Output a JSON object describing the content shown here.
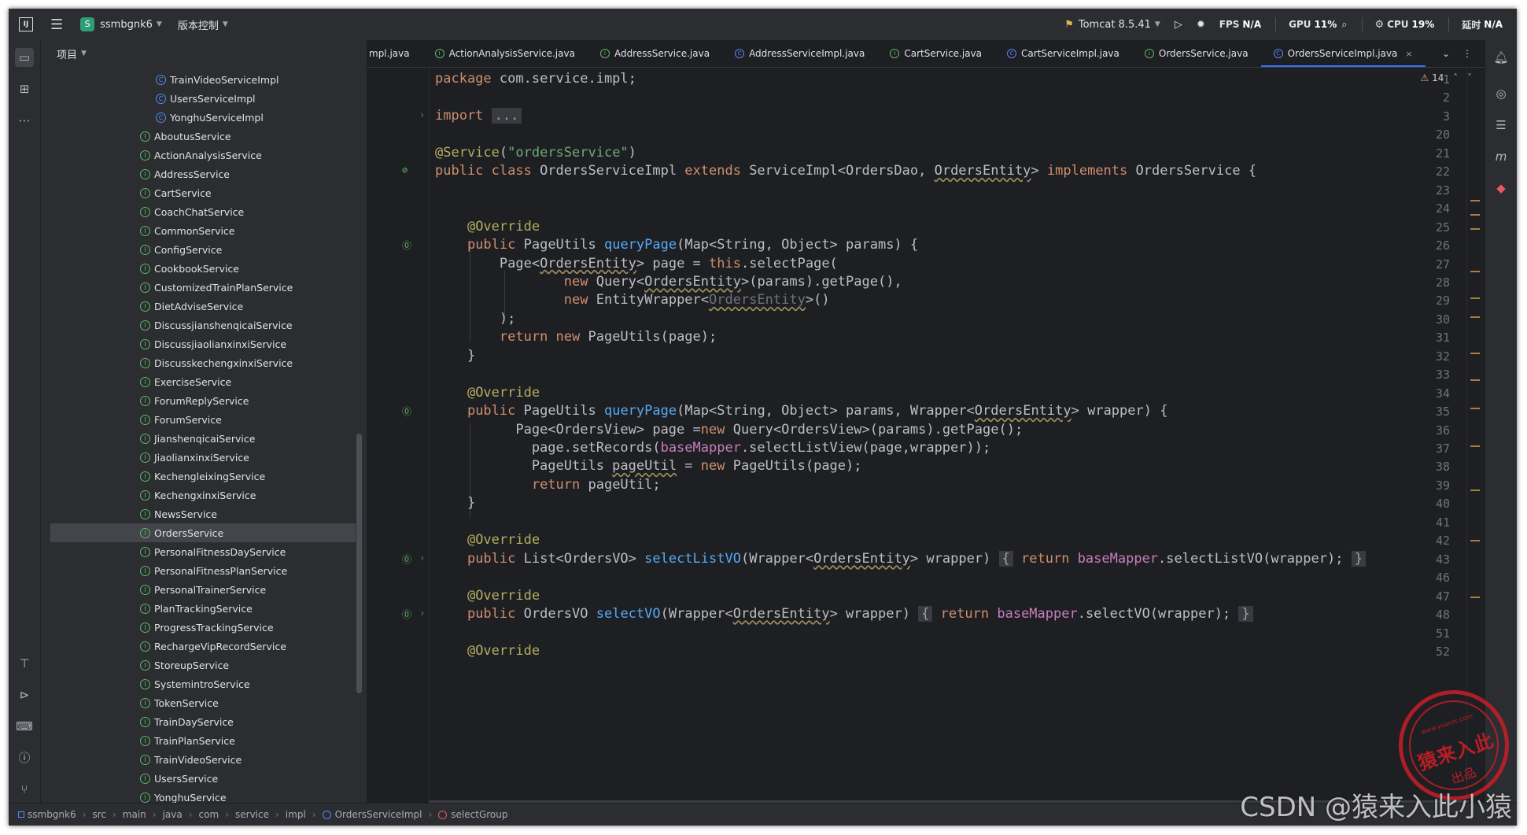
{
  "titlebar": {
    "project_badge": "S",
    "project_name": "ssmbgnk6",
    "vcs": "版本控制",
    "run_config": "Tomcat 8.5.41",
    "fps_label": "FPS",
    "fps_value": "N/A",
    "gpu_label": "GPU",
    "gpu_value": "11%",
    "cpu_label": "CPU",
    "cpu_value": "19%",
    "time_label": "延时",
    "time_value": "N/A"
  },
  "project_panel": {
    "title": "项目",
    "items": [
      {
        "label": "TrainVideoServiceImpl",
        "kind": "class",
        "indent": 2
      },
      {
        "label": "UsersServiceImpl",
        "kind": "class",
        "indent": 2
      },
      {
        "label": "YonghuServiceImpl",
        "kind": "class",
        "indent": 2
      },
      {
        "label": "AboutusService",
        "kind": "interface",
        "indent": 1
      },
      {
        "label": "ActionAnalysisService",
        "kind": "interface",
        "indent": 1
      },
      {
        "label": "AddressService",
        "kind": "interface",
        "indent": 1
      },
      {
        "label": "CartService",
        "kind": "interface",
        "indent": 1
      },
      {
        "label": "CoachChatService",
        "kind": "interface",
        "indent": 1
      },
      {
        "label": "CommonService",
        "kind": "interface",
        "indent": 1
      },
      {
        "label": "ConfigService",
        "kind": "interface",
        "indent": 1
      },
      {
        "label": "CookbookService",
        "kind": "interface",
        "indent": 1
      },
      {
        "label": "CustomizedTrainPlanService",
        "kind": "interface",
        "indent": 1
      },
      {
        "label": "DietAdviseService",
        "kind": "interface",
        "indent": 1
      },
      {
        "label": "DiscussjianshenqicaiService",
        "kind": "interface",
        "indent": 1
      },
      {
        "label": "DiscussjiaolianxinxiService",
        "kind": "interface",
        "indent": 1
      },
      {
        "label": "DiscusskechengxinxiService",
        "kind": "interface",
        "indent": 1
      },
      {
        "label": "ExerciseService",
        "kind": "interface",
        "indent": 1
      },
      {
        "label": "ForumReplyService",
        "kind": "interface",
        "indent": 1
      },
      {
        "label": "ForumService",
        "kind": "interface",
        "indent": 1
      },
      {
        "label": "JianshenqicaiService",
        "kind": "interface",
        "indent": 1
      },
      {
        "label": "JiaolianxinxiService",
        "kind": "interface",
        "indent": 1
      },
      {
        "label": "KechengleixingService",
        "kind": "interface",
        "indent": 1
      },
      {
        "label": "KechengxinxiService",
        "kind": "interface",
        "indent": 1
      },
      {
        "label": "NewsService",
        "kind": "interface",
        "indent": 1
      },
      {
        "label": "OrdersService",
        "kind": "interface",
        "indent": 1,
        "selected": true
      },
      {
        "label": "PersonalFitnessDayService",
        "kind": "interface",
        "indent": 1
      },
      {
        "label": "PersonalFitnessPlanService",
        "kind": "interface",
        "indent": 1
      },
      {
        "label": "PersonalTrainerService",
        "kind": "interface",
        "indent": 1
      },
      {
        "label": "PlanTrackingService",
        "kind": "interface",
        "indent": 1
      },
      {
        "label": "ProgressTrackingService",
        "kind": "interface",
        "indent": 1
      },
      {
        "label": "RechargeVipRecordService",
        "kind": "interface",
        "indent": 1
      },
      {
        "label": "StoreupService",
        "kind": "interface",
        "indent": 1
      },
      {
        "label": "SystemintroService",
        "kind": "interface",
        "indent": 1
      },
      {
        "label": "TokenService",
        "kind": "interface",
        "indent": 1
      },
      {
        "label": "TrainDayService",
        "kind": "interface",
        "indent": 1
      },
      {
        "label": "TrainPlanService",
        "kind": "interface",
        "indent": 1
      },
      {
        "label": "TrainVideoService",
        "kind": "interface",
        "indent": 1
      },
      {
        "label": "UsersService",
        "kind": "interface",
        "indent": 1
      },
      {
        "label": "YonghuService",
        "kind": "interface",
        "indent": 1
      }
    ]
  },
  "tabs": [
    {
      "label": "mpl.java",
      "kind": "none"
    },
    {
      "label": "ActionAnalysisService.java",
      "kind": "interface"
    },
    {
      "label": "AddressService.java",
      "kind": "interface"
    },
    {
      "label": "AddressServiceImpl.java",
      "kind": "class"
    },
    {
      "label": "CartService.java",
      "kind": "interface"
    },
    {
      "label": "CartServiceImpl.java",
      "kind": "class"
    },
    {
      "label": "OrdersService.java",
      "kind": "interface"
    },
    {
      "label": "OrdersServiceImpl.java",
      "kind": "class",
      "active": true
    }
  ],
  "editor": {
    "warning_count": "14",
    "lines": [
      {
        "n": "1",
        "html": "<span class=\"kw\">package</span> com.service.impl;"
      },
      {
        "n": "2",
        "html": ""
      },
      {
        "n": "3",
        "html": "<span class=\"kw\">import</span> <span class=\"foldbox\">...</span>",
        "fold": "›"
      },
      {
        "n": "20",
        "html": ""
      },
      {
        "n": "21",
        "html": "<span class=\"ann\">@Service</span>(<span class=\"str\">\"ordersService\"</span>)"
      },
      {
        "n": "22",
        "html": "<span class=\"kw\">public class</span> OrdersServiceImpl <span class=\"kw\">extends</span> ServiceImpl&lt;OrdersDao, <span class=\"wavy\">OrdersEntity</span>&gt; <span class=\"kw\">implements</span> OrdersService {",
        "mark": "bean"
      },
      {
        "n": "23",
        "html": ""
      },
      {
        "n": "24",
        "html": ""
      },
      {
        "n": "25",
        "html": "    <span class=\"ann\">@Override</span>"
      },
      {
        "n": "26",
        "html": "    <span class=\"kw\">public</span> PageUtils <span class=\"fn\">queryPage</span>(Map&lt;String, Object&gt; params) {",
        "mark": "impl"
      },
      {
        "n": "27",
        "html": "        Page&lt;<span class=\"wavy\">OrdersEntity</span>&gt; page = <span class=\"kw\">this</span>.selectPage("
      },
      {
        "n": "28",
        "html": "                <span class=\"kw\">new</span> Query&lt;<span class=\"wavy\">OrdersEntity</span>&gt;(params).getPage(),"
      },
      {
        "n": "29",
        "html": "                <span class=\"kw\">new</span> EntityWrapper&lt;<span class=\"wavy dim\">OrdersEntity</span>&gt;()"
      },
      {
        "n": "30",
        "html": "        );"
      },
      {
        "n": "31",
        "html": "        <span class=\"kw\">return new</span> PageUtils(page);"
      },
      {
        "n": "32",
        "html": "    }"
      },
      {
        "n": "33",
        "html": ""
      },
      {
        "n": "34",
        "html": "    <span class=\"ann\">@Override</span>"
      },
      {
        "n": "35",
        "html": "    <span class=\"kw\">public</span> PageUtils <span class=\"fn\">queryPage</span>(Map&lt;String, Object&gt; params, Wrapper&lt;<span class=\"wavy\">OrdersEntity</span>&gt; wrapper) {",
        "mark": "impl"
      },
      {
        "n": "36",
        "html": "          Page&lt;OrdersView&gt; page =<span class=\"kw\">new</span> Query&lt;OrdersView&gt;(params).getPage();"
      },
      {
        "n": "37",
        "html": "            page.setRecords(<span class=\"fld\">baseMapper</span>.selectListView(page,wrapper));"
      },
      {
        "n": "38",
        "html": "            PageUtils <span class=\"wavy\">pageUtil</span> = <span class=\"kw\">new</span> PageUtils(page);"
      },
      {
        "n": "39",
        "html": "            <span class=\"kw\">return</span> pageUtil;"
      },
      {
        "n": "40",
        "html": "    }"
      },
      {
        "n": "41",
        "html": ""
      },
      {
        "n": "42",
        "html": "    <span class=\"ann\">@Override</span>"
      },
      {
        "n": "43",
        "html": "    <span class=\"kw\">public</span> List&lt;OrdersVO&gt; <span class=\"fn\">selectListVO</span>(Wrapper&lt;<span class=\"wavy\">OrdersEntity</span>&gt; wrapper) <span class=\"foldbox\">{</span> <span class=\"kw\">return</span> <span class=\"fld\">baseMapper</span>.selectListVO(wrapper); <span class=\"foldbox\">}</span>",
        "mark": "impl",
        "fold": "›"
      },
      {
        "n": "46",
        "html": ""
      },
      {
        "n": "47",
        "html": "    <span class=\"ann\">@Override</span>"
      },
      {
        "n": "48",
        "html": "    <span class=\"kw\">public</span> OrdersVO <span class=\"fn\">selectVO</span>(Wrapper&lt;<span class=\"wavy\">OrdersEntity</span>&gt; wrapper) <span class=\"foldbox\">{</span> <span class=\"kw\">return</span> <span class=\"fld\">baseMapper</span>.selectVO(wrapper); <span class=\"foldbox\">}</span>",
        "mark": "impl",
        "fold": "›"
      },
      {
        "n": "51",
        "html": ""
      },
      {
        "n": "52",
        "html": "    <span class=\"ann\">@Override</span>"
      }
    ]
  },
  "breadcrumb": [
    "ssmbgnk6",
    "src",
    "main",
    "java",
    "com",
    "service",
    "impl",
    "OrdersServiceImpl",
    "selectGroup"
  ],
  "watermark": {
    "stamp_url": "www.yuanrc.com",
    "stamp_main": "猿来入此",
    "stamp_sub": "出品",
    "csdn": "CSDN @猿来入此小猿"
  },
  "colors": {
    "accent": "#3574f0",
    "keyword": "#cf8e6d",
    "string": "#6aab73",
    "annotation": "#b3ae60",
    "method": "#56a8f5",
    "field": "#c77dbb"
  }
}
